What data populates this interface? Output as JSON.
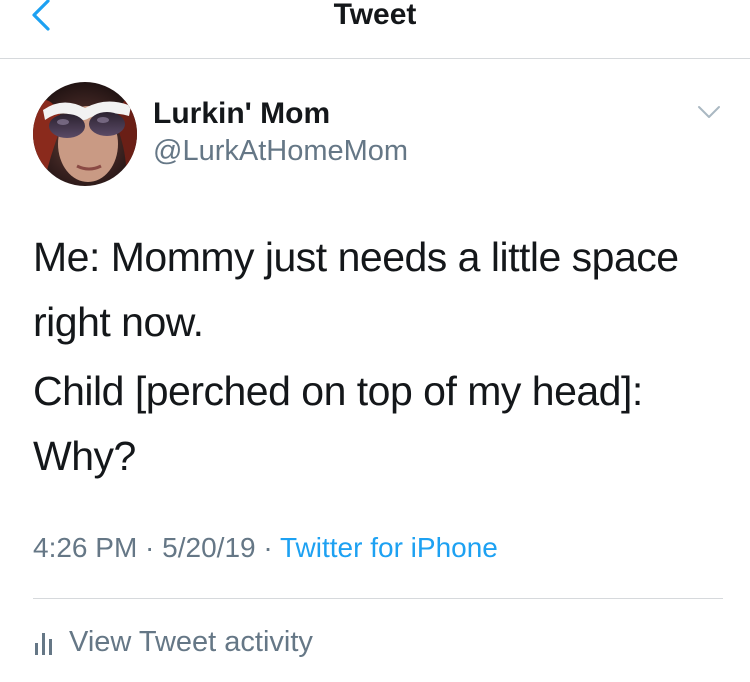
{
  "header": {
    "title": "Tweet",
    "back_icon": "chevron-left-icon",
    "accent_color": "#1da1f2"
  },
  "author": {
    "display_name": "Lurkin' Mom",
    "handle": "@LurkAtHomeMom",
    "avatar_icon": "profile-photo",
    "more_icon": "chevron-down-icon"
  },
  "tweet": {
    "paragraphs": [
      "Me: Mommy just needs a little space right now.",
      "Child [perched on top of my head]: Why?"
    ]
  },
  "meta": {
    "time": "4:26 PM",
    "separator": " · ",
    "date": "5/20/19",
    "source": "Twitter for iPhone"
  },
  "activity": {
    "label": "View Tweet activity",
    "icon": "bar-chart-icon"
  },
  "colors": {
    "text": "#14171a",
    "secondary": "#657786",
    "link": "#1da1f2",
    "divider": "#d6d9dc"
  }
}
